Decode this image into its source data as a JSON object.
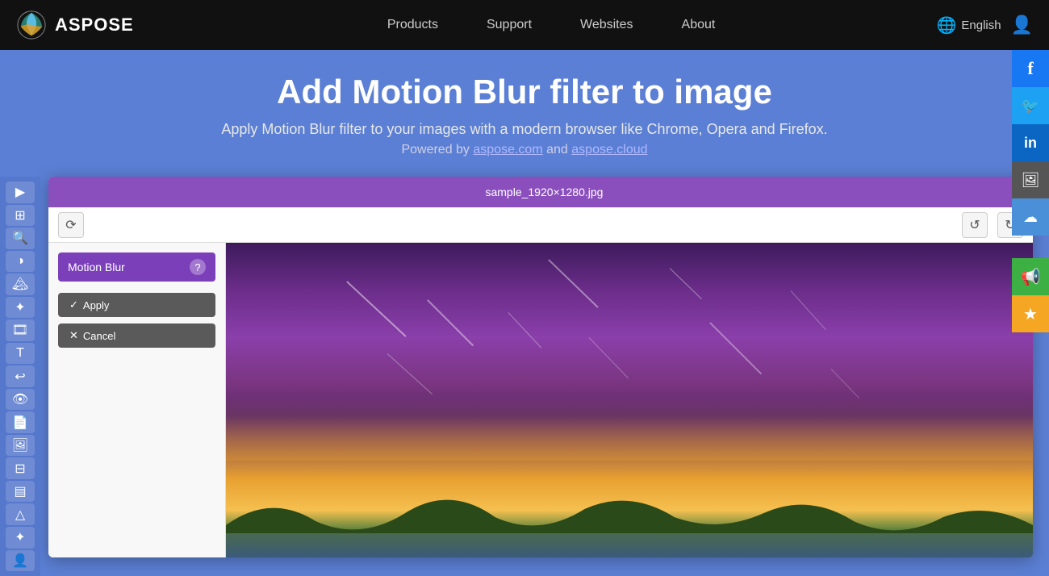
{
  "brand": {
    "name": "ASPOSE",
    "logo_alt": "Aspose Logo"
  },
  "nav": {
    "links": [
      {
        "id": "products",
        "label": "Products"
      },
      {
        "id": "support",
        "label": "Support"
      },
      {
        "id": "websites",
        "label": "Websites"
      },
      {
        "id": "about",
        "label": "About"
      }
    ],
    "language": "English",
    "language_icon": "🌐"
  },
  "hero": {
    "title": "Add Motion Blur filter to image",
    "subtitle": "Apply Motion Blur filter to your images with a modern browser like Chrome, Opera and Firefox.",
    "powered_by": "Powered by",
    "site1": "aspose.com",
    "site2": "aspose.cloud",
    "and_text": "and"
  },
  "editor": {
    "filename": "sample_1920×1280.jpg",
    "filter_name": "Motion Blur",
    "apply_label": "Apply",
    "cancel_label": "Cancel",
    "help_icon": "?",
    "close_icon": "✕",
    "undo_icon": "↺",
    "redo_icon": "↻",
    "reset_icon": "⟳"
  },
  "social": [
    {
      "id": "facebook",
      "icon": "f",
      "bg": "#1877f2"
    },
    {
      "id": "twitter",
      "icon": "t",
      "bg": "#1da1f2"
    },
    {
      "id": "linkedin",
      "icon": "in",
      "bg": "#0a66c2"
    },
    {
      "id": "image-share",
      "icon": "🖼",
      "bg": "#555"
    },
    {
      "id": "cloud",
      "icon": "☁",
      "bg": "#4a90d9"
    },
    {
      "id": "announce",
      "icon": "📢",
      "bg": "#3cb043"
    },
    {
      "id": "star",
      "icon": "★",
      "bg": "#f5a623"
    }
  ],
  "sidebar_tools": [
    {
      "id": "arrow-right",
      "icon": "▶"
    },
    {
      "id": "transform",
      "icon": "⊞"
    },
    {
      "id": "zoom",
      "icon": "🔍"
    },
    {
      "id": "color",
      "icon": "◑"
    },
    {
      "id": "landscape",
      "icon": "🏔"
    },
    {
      "id": "image-fx",
      "icon": "✦"
    },
    {
      "id": "film",
      "icon": "🎞"
    },
    {
      "id": "text",
      "icon": "T"
    },
    {
      "id": "back",
      "icon": "↩"
    },
    {
      "id": "eye",
      "icon": "👁"
    },
    {
      "id": "document",
      "icon": "📄"
    },
    {
      "id": "gallery",
      "icon": "🖼"
    },
    {
      "id": "grid",
      "icon": "⊞"
    },
    {
      "id": "layers",
      "icon": "▤"
    },
    {
      "id": "mountain",
      "icon": "△"
    },
    {
      "id": "sparkle",
      "icon": "✦"
    },
    {
      "id": "person",
      "icon": "👤"
    }
  ]
}
